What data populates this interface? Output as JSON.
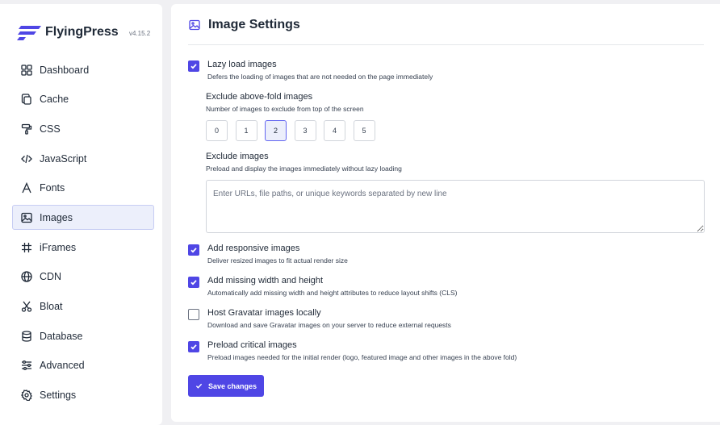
{
  "brand": {
    "name": "FlyingPress",
    "version": "v4.15.2"
  },
  "sidebar": {
    "items": [
      {
        "label": "Dashboard",
        "icon": "grid-icon"
      },
      {
        "label": "Cache",
        "icon": "copy-icon"
      },
      {
        "label": "CSS",
        "icon": "paint-roller-icon"
      },
      {
        "label": "JavaScript",
        "icon": "code-icon"
      },
      {
        "label": "Fonts",
        "icon": "font-icon"
      },
      {
        "label": "Images",
        "icon": "image-icon",
        "active": true
      },
      {
        "label": "iFrames",
        "icon": "hash-icon"
      },
      {
        "label": "CDN",
        "icon": "globe-icon"
      },
      {
        "label": "Bloat",
        "icon": "scissors-icon"
      },
      {
        "label": "Database",
        "icon": "database-icon"
      },
      {
        "label": "Advanced",
        "icon": "sliders-icon"
      },
      {
        "label": "Settings",
        "icon": "gear-icon"
      }
    ]
  },
  "page": {
    "title": "Image Settings"
  },
  "options": {
    "lazy_load": {
      "title": "Lazy load images",
      "desc": "Defers the loading of images that are not needed on the page immediately",
      "checked": true
    },
    "exclude_above_fold": {
      "title": "Exclude above-fold images",
      "desc": "Number of images to exclude from top of the screen",
      "values": [
        "0",
        "1",
        "2",
        "3",
        "4",
        "5"
      ],
      "selected": "2"
    },
    "exclude_images": {
      "title": "Exclude images",
      "desc": "Preload and display the images immediately without lazy loading",
      "placeholder": "Enter URLs, file paths, or unique keywords separated by new line"
    },
    "responsive": {
      "title": "Add responsive images",
      "desc": "Deliver resized images to fit actual render size",
      "checked": true
    },
    "width_height": {
      "title": "Add missing width and height",
      "desc": "Automatically add missing width and height attributes to reduce layout shifts (CLS)",
      "checked": true
    },
    "gravatar": {
      "title": "Host Gravatar images locally",
      "desc": "Download and save Gravatar images on your server to reduce external requests",
      "checked": false
    },
    "preload_critical": {
      "title": "Preload critical images",
      "desc": "Preload images needed for the initial render (logo, featured image and other images in the above fold)",
      "checked": true
    }
  },
  "actions": {
    "save_label": "Save changes"
  },
  "colors": {
    "accent": "#4f46e5",
    "active_bg": "#eceffb"
  }
}
